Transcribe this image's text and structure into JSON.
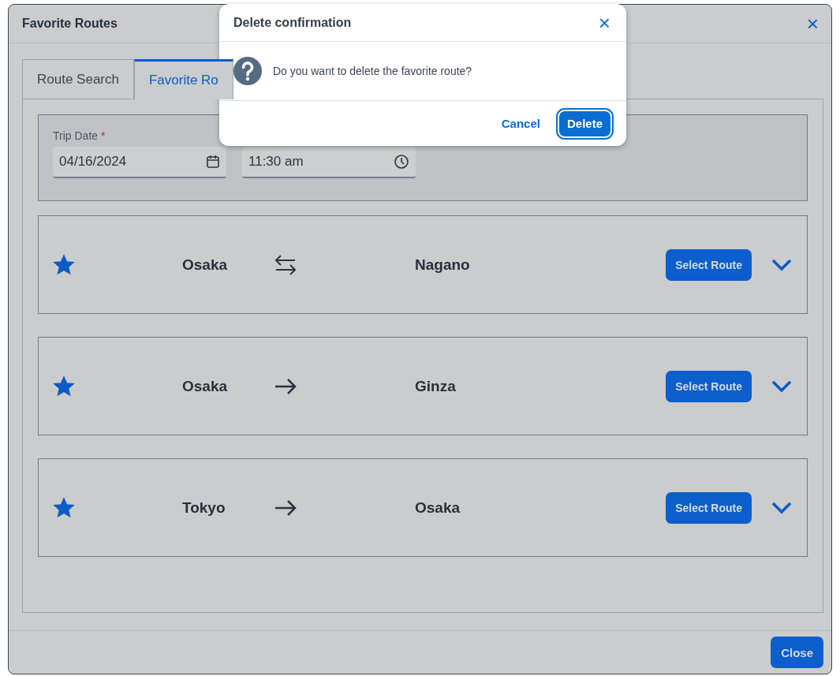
{
  "window": {
    "title": "Favorite Routes",
    "close_icon": "×"
  },
  "tabs": [
    {
      "label": "Route Search",
      "selected": false
    },
    {
      "label": "Favorite Ro",
      "selected": true
    }
  ],
  "trip": {
    "date_label": "Trip Date",
    "required": true,
    "required_mark": "*",
    "date_value": "04/16/2024",
    "time_value": "11:30 am"
  },
  "routes": [
    {
      "favorite": true,
      "from": "Osaka",
      "kind": "round-trip",
      "to": "Nagano",
      "button": "Select Route",
      "expanded": false
    },
    {
      "favorite": true,
      "from": "Osaka",
      "kind": "one-way",
      "to": "Ginza",
      "button": "Select Route",
      "expanded": false
    },
    {
      "favorite": true,
      "from": "Tokyo",
      "kind": "one-way",
      "to": "Osaka",
      "button": "Select Route",
      "expanded": false
    }
  ],
  "footer": {
    "button": "Close"
  },
  "modal": {
    "title": "Delete confirmation",
    "message": "Do you want to delete the favorite route?",
    "buttons": [
      {
        "label": "Cancel",
        "kind": "link"
      },
      {
        "label": "Delete",
        "kind": "primary"
      }
    ]
  }
}
